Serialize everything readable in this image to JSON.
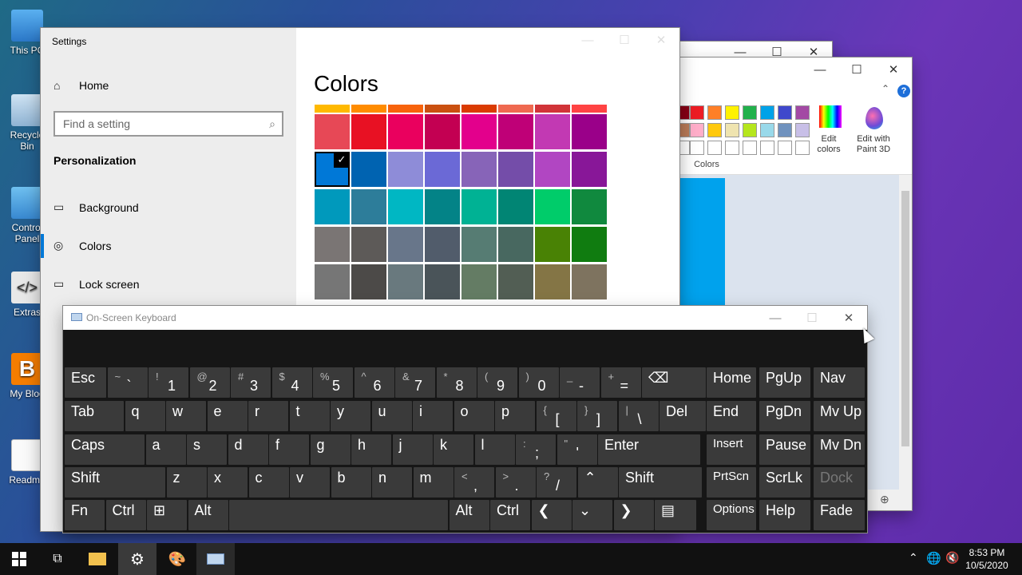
{
  "desktop": {
    "icons": [
      {
        "label": "This PC"
      },
      {
        "label": "Recycle Bin"
      },
      {
        "label": "Control Panel"
      },
      {
        "label": "Extras"
      },
      {
        "label": "My Blog"
      },
      {
        "label": "Readme"
      }
    ]
  },
  "paint": {
    "colors_group_label": "Colors",
    "edit_colors_label": "Edit colors",
    "edit_paint3d_label": "Edit with Paint 3D",
    "palette_top": [
      "#ed1c24",
      "#ff7f27",
      "#fff200",
      "#22b14c",
      "#00a2e8",
      "#3f48cc",
      "#a349a4"
    ],
    "palette_mid": [
      "#ffaec9",
      "#ffc90e",
      "#efe4b0",
      "#b5e61d",
      "#99d9ea",
      "#7092be",
      "#c8bfe7"
    ]
  },
  "settings": {
    "title": "Settings",
    "home": "Home",
    "search_placeholder": "Find a setting",
    "section": "Personalization",
    "nav": [
      {
        "label": "Background"
      },
      {
        "label": "Colors"
      },
      {
        "label": "Lock screen"
      }
    ],
    "page_title": "Colors",
    "accent_bar": [
      "#ffb900",
      "#ff8c00",
      "#f7630c",
      "#ca5010",
      "#da3b01",
      "#ef6950",
      "#d13438",
      "#ff4343"
    ],
    "color_rows": [
      [
        "#e74856",
        "#e81123",
        "#ea005e",
        "#c30052",
        "#e3008c",
        "#bf0077",
        "#c239b3",
        "#9a0089"
      ],
      [
        "#0078d7",
        "#0063b1",
        "#8e8cd8",
        "#6b69d6",
        "#8764b8",
        "#744da9",
        "#b146c2",
        "#881798"
      ],
      [
        "#0099bc",
        "#2d7d9a",
        "#00b7c3",
        "#038387",
        "#00b294",
        "#018574",
        "#00cc6a",
        "#10893e"
      ],
      [
        "#7a7574",
        "#5d5a58",
        "#68768a",
        "#515c6b",
        "#567c73",
        "#486860",
        "#498205",
        "#107c10"
      ],
      [
        "#767676",
        "#4c4a48",
        "#69797e",
        "#4a5459",
        "#647c64",
        "#525e54",
        "#847545",
        "#7e735f"
      ]
    ],
    "selected": "#0078d7"
  },
  "osk": {
    "title": "On-Screen Keyboard",
    "rows": [
      [
        {
          "main": "Esc"
        },
        {
          "sub": "~",
          "base": "`"
        },
        {
          "sub": "!",
          "base": "1"
        },
        {
          "sub": "@",
          "base": "2"
        },
        {
          "sub": "#",
          "base": "3"
        },
        {
          "sub": "$",
          "base": "4"
        },
        {
          "sub": "%",
          "base": "5"
        },
        {
          "sub": "^",
          "base": "6"
        },
        {
          "sub": "&",
          "base": "7"
        },
        {
          "sub": "*",
          "base": "8"
        },
        {
          "sub": "(",
          "base": "9"
        },
        {
          "sub": ")",
          "base": "0"
        },
        {
          "sub": "_",
          "base": "-"
        },
        {
          "sub": "+",
          "base": "="
        },
        {
          "main": "⌫"
        }
      ],
      [
        {
          "main": "Tab"
        },
        {
          "main": "q"
        },
        {
          "main": "w"
        },
        {
          "main": "e"
        },
        {
          "main": "r"
        },
        {
          "main": "t"
        },
        {
          "main": "y"
        },
        {
          "main": "u"
        },
        {
          "main": "i"
        },
        {
          "main": "o"
        },
        {
          "main": "p"
        },
        {
          "sub": "{",
          "base": "["
        },
        {
          "sub": "}",
          "base": "]"
        },
        {
          "sub": "|",
          "base": "\\"
        },
        {
          "main": "Del"
        }
      ],
      [
        {
          "main": "Caps"
        },
        {
          "main": "a"
        },
        {
          "main": "s"
        },
        {
          "main": "d"
        },
        {
          "main": "f"
        },
        {
          "main": "g"
        },
        {
          "main": "h"
        },
        {
          "main": "j"
        },
        {
          "main": "k"
        },
        {
          "main": "l"
        },
        {
          "sub": ":",
          "base": ";"
        },
        {
          "sub": "\"",
          "base": "'"
        },
        {
          "main": "Enter"
        }
      ],
      [
        {
          "main": "Shift"
        },
        {
          "main": "z"
        },
        {
          "main": "x"
        },
        {
          "main": "c"
        },
        {
          "main": "v"
        },
        {
          "main": "b"
        },
        {
          "main": "n"
        },
        {
          "main": "m"
        },
        {
          "sub": "<",
          "base": ","
        },
        {
          "sub": ">",
          "base": "."
        },
        {
          "sub": "?",
          "base": "/"
        },
        {
          "main": "⌃"
        },
        {
          "main": "Shift"
        }
      ],
      [
        {
          "main": "Fn"
        },
        {
          "main": "Ctrl"
        },
        {
          "main": "⊞"
        },
        {
          "main": "Alt"
        },
        {
          "main": ""
        },
        {
          "main": "Alt"
        },
        {
          "main": "Ctrl"
        },
        {
          "main": "❮"
        },
        {
          "main": "⌄"
        },
        {
          "main": "❯"
        },
        {
          "main": "▤"
        }
      ]
    ],
    "nav_rows": [
      [
        "Home",
        "PgUp",
        "Nav"
      ],
      [
        "End",
        "PgDn",
        "Mv Up"
      ],
      [
        "Insert",
        "Pause",
        "Mv Dn"
      ],
      [
        "PrtScn",
        "ScrLk",
        "Dock"
      ],
      [
        "Options",
        "Help",
        "Fade"
      ]
    ]
  },
  "taskbar": {
    "time": "8:53 PM",
    "date": "10/5/2020"
  }
}
